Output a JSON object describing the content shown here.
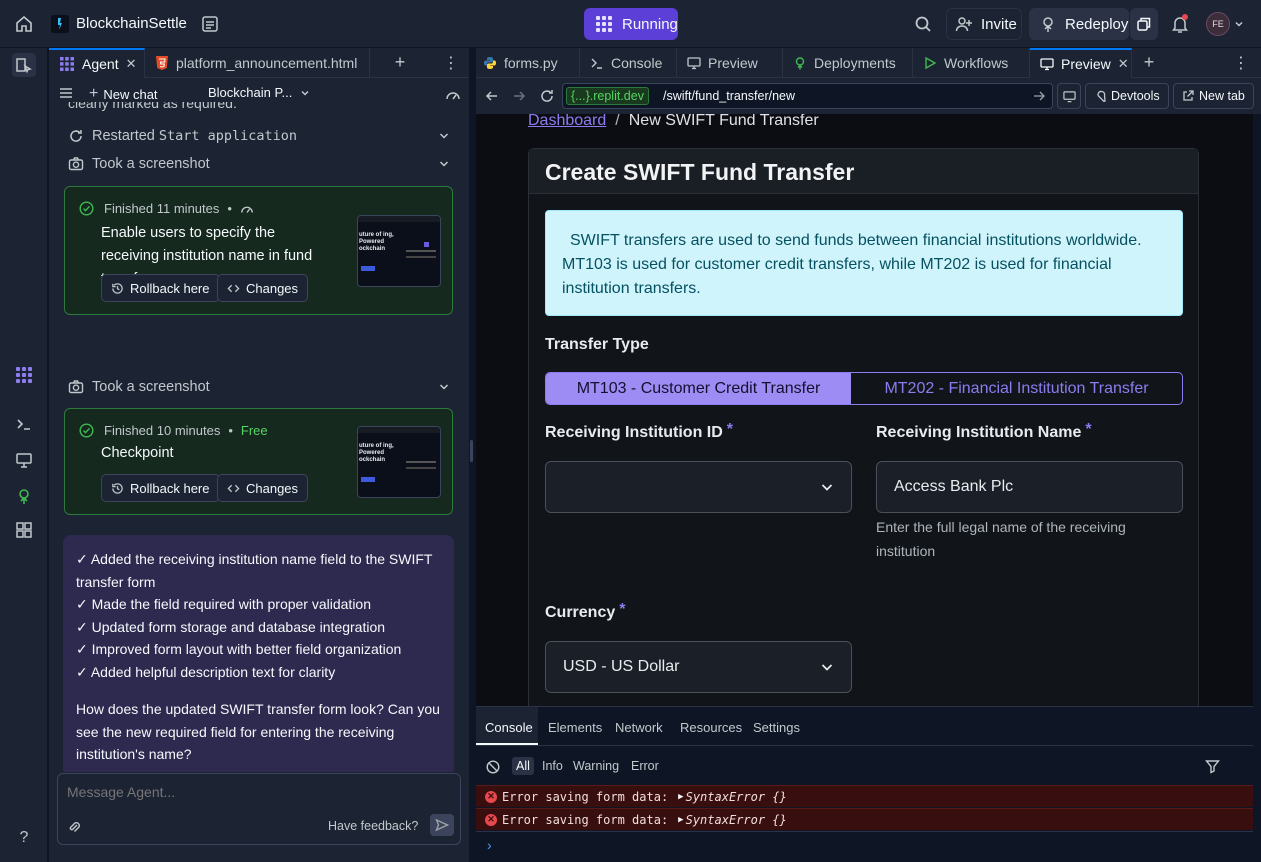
{
  "topbar": {
    "project_name": "BlockchainSettle",
    "run_status": "Running",
    "invite_label": "Invite",
    "redeploy_label": "Redeploy",
    "avatar_initials": "FE",
    "colors": {
      "running": "#5b3fd6",
      "notification_dot": "#e5484d"
    }
  },
  "agent_tabs": [
    {
      "label": "Agent",
      "icon": "agent-icon",
      "active": true
    },
    {
      "label": "platform_announcement.html",
      "icon": "html-file-icon",
      "active": false
    }
  ],
  "agent_toolbar": {
    "new_chat_label": "New chat",
    "chat_title": "Blockchain P..."
  },
  "agent_feed": {
    "cut_text": "clearly marked as required.",
    "restarted_prefix": "Restarted",
    "restarted_target": "Start application",
    "screenshot_label_1": "Took a screenshot",
    "checkpoint_1": {
      "meta": "Finished 11 minutes",
      "title": "Enable users to specify the receiving institution name in fund transfers",
      "rollback_label": "Rollback here",
      "changes_label": "Changes"
    },
    "screenshot_label_2": "Took a screenshot",
    "checkpoint_2": {
      "meta": "Finished 10 minutes",
      "badge": "Free",
      "title": "Checkpoint",
      "rollback_label": "Rollback here",
      "changes_label": "Changes"
    },
    "thumbnail_text": "uture of ing, Powered ockchain",
    "summary": {
      "items": [
        "✓ Added the receiving institution name field to the SWIFT transfer form",
        "✓ Made the field required with proper validation",
        "✓ Updated form storage and database integration",
        "✓ Improved form layout with better field organization",
        "✓ Added helpful description text for clarity"
      ],
      "question": "How does the updated SWIFT transfer form look? Can you see the new required field for entering the receiving institution's name?"
    }
  },
  "composer": {
    "placeholder": "Message Agent...",
    "feedback_label": "Have feedback?"
  },
  "right_tabs": [
    {
      "label": "forms.py",
      "icon": "python-icon",
      "active": false
    },
    {
      "label": "Console",
      "icon": "terminal-icon",
      "active": false
    },
    {
      "label": "Preview",
      "icon": "monitor-icon",
      "active": false
    },
    {
      "label": "Deployments",
      "icon": "deploy-icon",
      "active": false
    },
    {
      "label": "Workflows",
      "icon": "play-icon",
      "active": false
    },
    {
      "label": "Preview",
      "icon": "monitor-icon",
      "active": true
    }
  ],
  "browser": {
    "domain": "{...}.replit.dev",
    "path": "/swift/fund_transfer/new",
    "devtools_label": "Devtools",
    "new_tab_label": "New tab"
  },
  "page": {
    "breadcrumb_link": "Dashboard",
    "breadcrumb_sep": "/",
    "breadcrumb_current": "New SWIFT Fund Transfer",
    "card_title": "Create SWIFT Fund Transfer",
    "info_text": "SWIFT transfers are used to send funds between financial institutions worldwide. MT103 is used for customer credit transfers, while MT202 is used for financial institution transfers.",
    "transfer_type_label": "Transfer Type",
    "transfer_options": [
      "MT103 - Customer Credit Transfer",
      "MT202 - Financial Institution Transfer"
    ],
    "institution_id_label": "Receiving Institution ID",
    "institution_id_value": "",
    "institution_name_label": "Receiving Institution Name",
    "institution_name_value": "Access Bank Plc",
    "institution_name_help": "Enter the full legal name of the receiving institution",
    "currency_label": "Currency",
    "currency_value": "USD - US Dollar",
    "required_mark": "*",
    "colors": {
      "accent": "#8c7cf0",
      "info_bg": "#cff4fc",
      "info_text": "#055160",
      "required": "#8c7cf0"
    }
  },
  "devconsole": {
    "tabs": [
      "Console",
      "Elements",
      "Network",
      "Resources",
      "Settings"
    ],
    "filters": [
      "All",
      "Info",
      "Warning",
      "Error"
    ],
    "errors": [
      {
        "message": "Error saving form data:",
        "detail": "SyntaxError {}"
      },
      {
        "message": "Error saving form data:",
        "detail": "SyntaxError {}"
      }
    ]
  }
}
